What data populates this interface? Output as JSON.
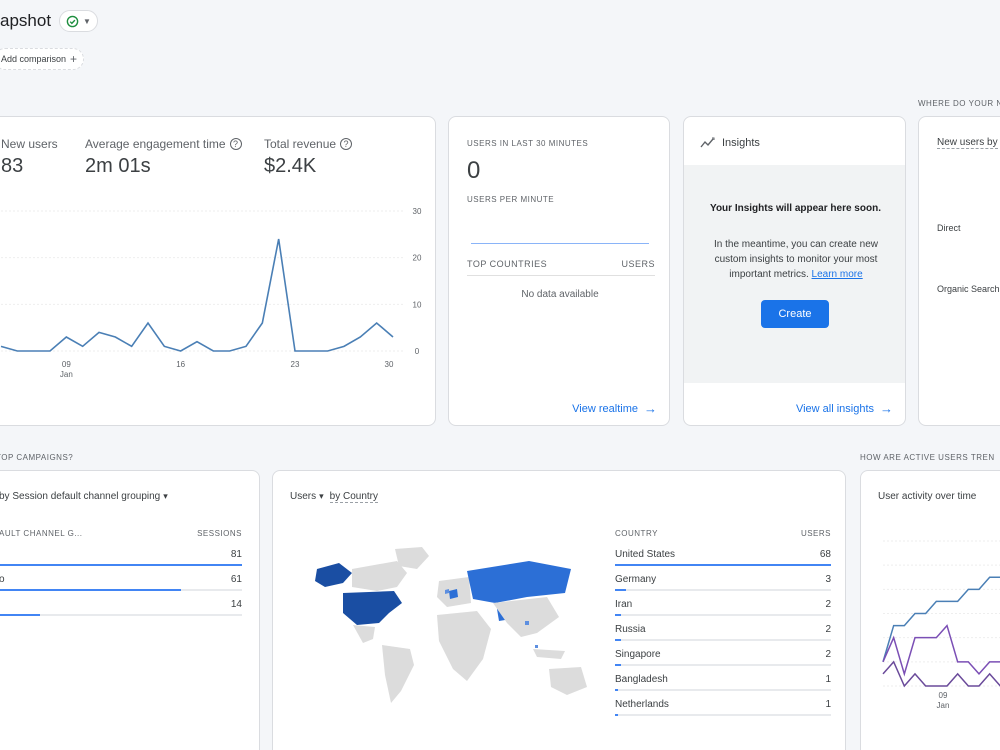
{
  "header": {
    "title": "apshot",
    "add_comparison": "Add comparison",
    "add_icon": "+"
  },
  "overview": {
    "metrics": [
      {
        "label": "New users",
        "value": "83"
      },
      {
        "label": "Average engagement time",
        "value": "2m 01s"
      },
      {
        "label": "Total revenue",
        "value": "$2.4K"
      }
    ],
    "help_glyph": "?",
    "chart_data": {
      "type": "line",
      "x": [
        "05",
        "06",
        "07",
        "08",
        "09",
        "10",
        "11",
        "12",
        "13",
        "14",
        "15",
        "16",
        "17",
        "18",
        "19",
        "20",
        "21",
        "22",
        "23",
        "24",
        "25",
        "26",
        "27",
        "28",
        "29",
        "30",
        "31"
      ],
      "series": [
        {
          "values": [
            1,
            0,
            0,
            0,
            3,
            1,
            4,
            3,
            1,
            6,
            1,
            0,
            2,
            0,
            0,
            1,
            6,
            24,
            0,
            0,
            0,
            1,
            3,
            6,
            3
          ]
        }
      ],
      "x_ticks": [
        {
          "label": "09",
          "sub": "Jan"
        },
        {
          "label": "16"
        },
        {
          "label": "23"
        },
        {
          "label": "30"
        }
      ],
      "y_ticks": [
        "30",
        "20",
        "10",
        "0"
      ],
      "ylim": [
        0,
        30
      ],
      "color": "#4a7fb5"
    }
  },
  "realtime": {
    "users_label": "USERS IN LAST 30 MINUTES",
    "users_value": "0",
    "per_minute_label": "USERS PER MINUTE",
    "col_country": "TOP COUNTRIES",
    "col_users": "USERS",
    "empty": "No data available",
    "link": "View realtime"
  },
  "insights": {
    "title": "Insights",
    "headline": "Your Insights will appear here soon.",
    "body": "In the meantime, you can create new custom insights to monitor your most important metrics.",
    "learn_more": "Learn more",
    "create": "Create",
    "link": "View all insights"
  },
  "where": {
    "section_label": "WHERE DO YOUR N",
    "selector": "New users by",
    "items": [
      "Direct",
      "Organic Search"
    ]
  },
  "campaigns": {
    "section_label": "TOP CAMPAIGNS?",
    "selector": "by Session default channel grouping",
    "col_name": "AULT CHANNEL G...",
    "col_value": "SESSIONS",
    "rows": [
      {
        "label": "",
        "value": "81",
        "fraction": 1.0
      },
      {
        "label": "o",
        "value": "61",
        "fraction": 0.75
      },
      {
        "label": "",
        "value": "14",
        "fraction": 0.17
      }
    ]
  },
  "country": {
    "selector_metric": "Users",
    "selector_dim": "by Country",
    "col_country": "COUNTRY",
    "col_users": "USERS",
    "rows": [
      {
        "label": "United States",
        "value": "68",
        "fraction": 1.0
      },
      {
        "label": "Germany",
        "value": "3",
        "fraction": 0.05
      },
      {
        "label": "Iran",
        "value": "2",
        "fraction": 0.03
      },
      {
        "label": "Russia",
        "value": "2",
        "fraction": 0.03
      },
      {
        "label": "Singapore",
        "value": "2",
        "fraction": 0.03
      },
      {
        "label": "Bangladesh",
        "value": "1",
        "fraction": 0.015
      },
      {
        "label": "Netherlands",
        "value": "1",
        "fraction": 0.015
      }
    ],
    "colors": {
      "land": "#dcdcdc",
      "dark": "#1a4ea3",
      "mid": "#2c6fd6",
      "light": "#5d8fe0"
    }
  },
  "activity": {
    "section_label": "HOW ARE ACTIVE USERS TREN",
    "title": "User activity over time",
    "x_ticks": [
      {
        "label": "09",
        "sub": "Jan"
      }
    ],
    "series": [
      {
        "color": "#4a7fb5",
        "values": [
          2,
          5,
          5,
          6,
          6,
          7,
          7,
          7,
          8,
          8,
          9,
          9,
          10
        ]
      },
      {
        "color": "#7b4fb5",
        "values": [
          2,
          4,
          1,
          4,
          4,
          4,
          5,
          2,
          2,
          1,
          2,
          2,
          1
        ]
      },
      {
        "color": "#6a4a9a",
        "values": [
          1,
          2,
          0,
          1,
          0,
          0,
          0,
          1,
          0,
          0,
          1,
          0,
          0
        ]
      }
    ]
  }
}
